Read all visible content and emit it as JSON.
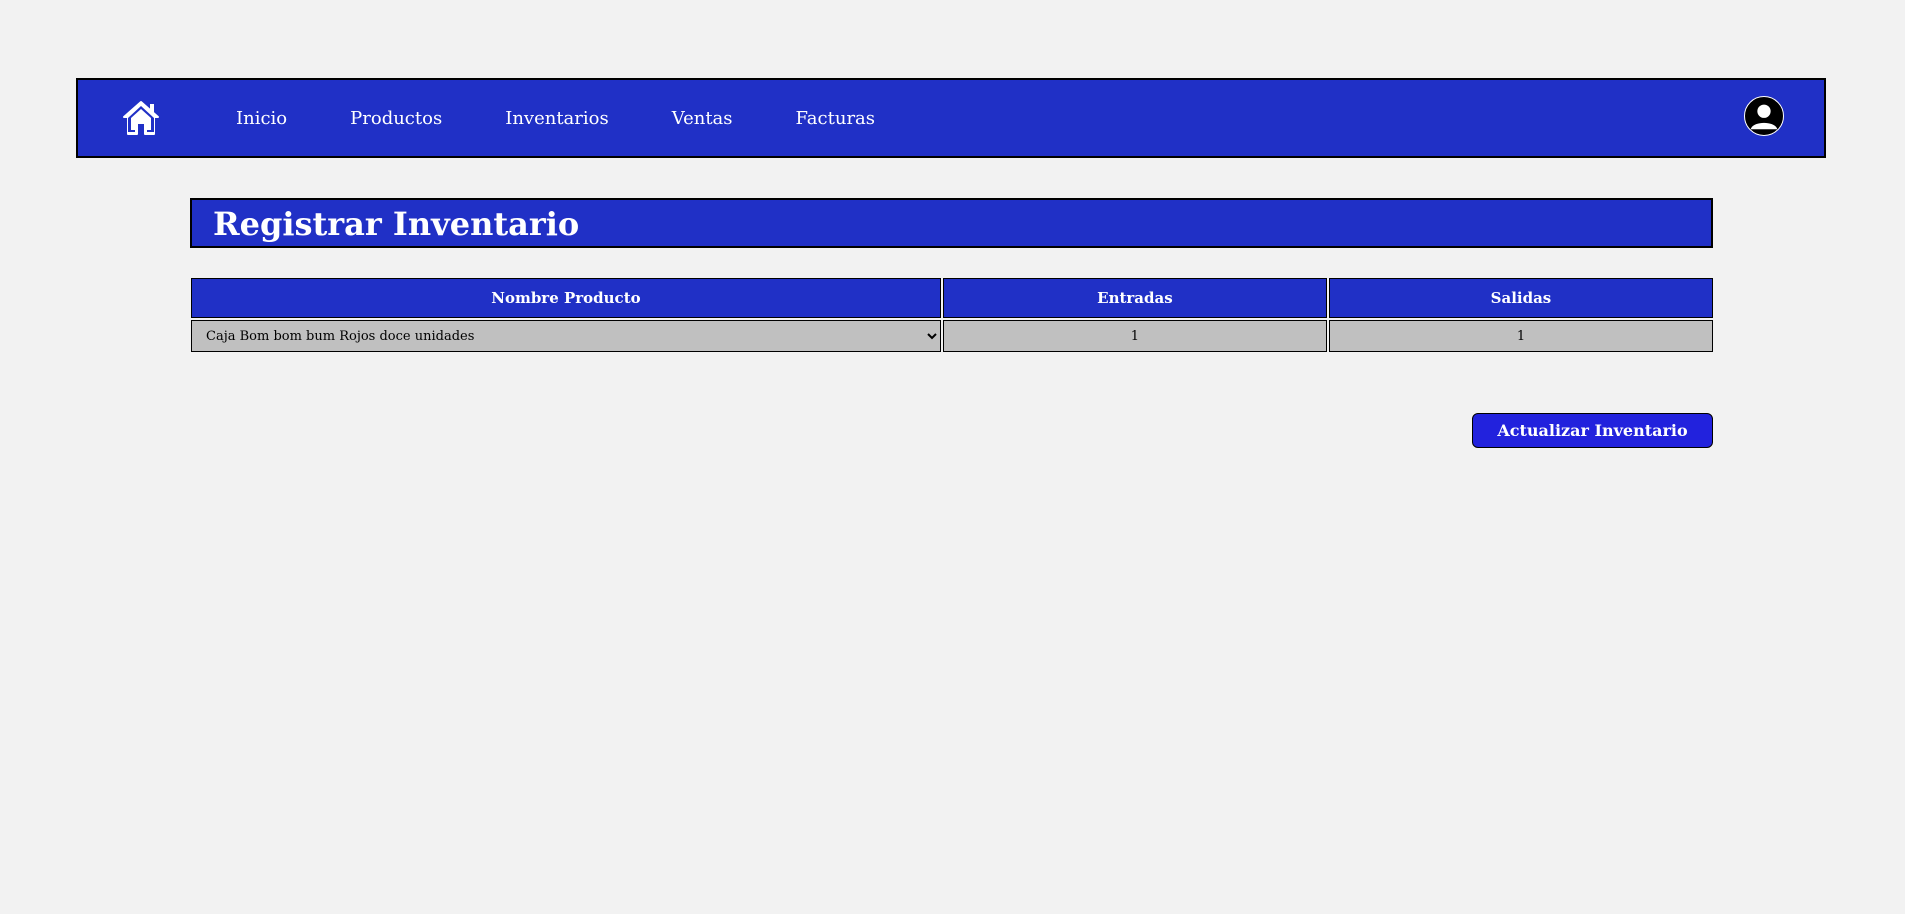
{
  "colors": {
    "primary": "#2030c6",
    "button": "#2222dd",
    "cell_bg": "#c0c0c0",
    "page_bg": "#f2f2f2"
  },
  "nav": {
    "home_icon": "home-icon",
    "items": [
      {
        "label": "Inicio"
      },
      {
        "label": "Productos"
      },
      {
        "label": "Inventarios"
      },
      {
        "label": "Ventas"
      },
      {
        "label": "Facturas"
      }
    ],
    "avatar_icon": "user-avatar-icon"
  },
  "page": {
    "title": "Registrar Inventario"
  },
  "table": {
    "headers": [
      "Nombre Producto",
      "Entradas",
      "Salidas"
    ],
    "rows": [
      {
        "product": "Caja Bom bom bum Rojos doce unidades",
        "entradas": "1",
        "salidas": "1"
      }
    ]
  },
  "actions": {
    "update_label": "Actualizar Inventario"
  }
}
